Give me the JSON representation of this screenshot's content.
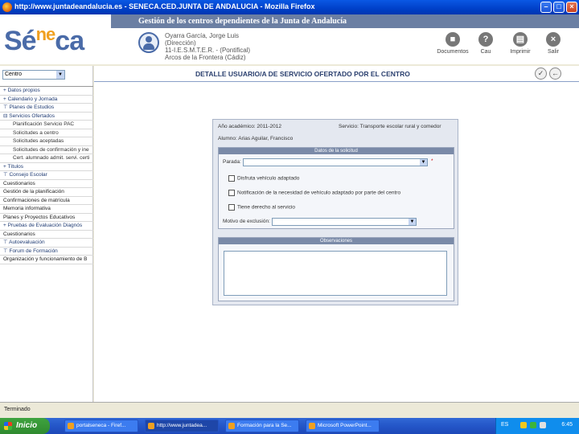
{
  "window": {
    "title": "http://www.juntadeandalucia.es - SENECA.CED.JUNTA DE ANDALUCIA - Mozilla Firefox"
  },
  "header": {
    "banner": "Gestión de los centros dependientes de la Junta de Andalucía",
    "logo_main": "Sé",
    "logo_accent": "ne",
    "logo_end": "ca",
    "user_lines": [
      "Oyarra García, Jorge Luis",
      "(Dirección)",
      "11-I.E.S.M.T.E.R. - (Pontifical)",
      "Arcos de la Frontera (Cádiz)"
    ],
    "buttons": [
      {
        "label": "Documentos",
        "icon": "documents-icon"
      },
      {
        "label": "Cau",
        "icon": "help-icon"
      },
      {
        "label": "Imprimir",
        "icon": "print-icon"
      },
      {
        "label": "Salir",
        "icon": "exit-icon"
      }
    ]
  },
  "sidebar": {
    "select_value": "Centro",
    "items": [
      {
        "label": "+ Datos propios",
        "type": "top"
      },
      {
        "label": "+ Calendario y Jornada",
        "type": "top"
      },
      {
        "label": "⊤ Planes de Estudios",
        "type": "top"
      },
      {
        "label": "⊟ Servicios Ofertados",
        "type": "top"
      },
      {
        "label": "Planificación Servicio PAC",
        "type": "sub"
      },
      {
        "label": "Solicitudes a centro",
        "type": "sub"
      },
      {
        "label": "Solicitudes aceptadas",
        "type": "sub"
      },
      {
        "label": "Solicitudes de confirmación y ine",
        "type": "sub"
      },
      {
        "label": "Cert. alumnado admit. servi. certi",
        "type": "sub"
      },
      {
        "label": "+ Títulos",
        "type": "top"
      },
      {
        "label": "⊤ Consejo Escolar",
        "type": "top"
      },
      {
        "label": "Cuestionarios",
        "type": "plain"
      },
      {
        "label": "Gestión de la planificación",
        "type": "plain"
      },
      {
        "label": "Confirmaciones de matrícula",
        "type": "plain"
      },
      {
        "label": "Memoria informativa",
        "type": "plain"
      },
      {
        "label": "Planes y Proyectos Educativos",
        "type": "plain"
      },
      {
        "label": "+ Pruebas de Evaluación Diagnós",
        "type": "top"
      },
      {
        "label": "Cuestionarios",
        "type": "plain"
      },
      {
        "label": "⊤ Autoevaluación",
        "type": "top"
      },
      {
        "label": "⊤ Forum de Formación",
        "type": "top"
      },
      {
        "label": "Organización y funcionamiento de B",
        "type": "plain"
      }
    ]
  },
  "main": {
    "title": "DETALLE USUARIO/A DE SERVICIO OFERTADO POR EL CENTRO",
    "year_label": "Año académico: 2011-2012",
    "service_label": "Servicio: Transporte escolar rural y comedor",
    "student_label": "Alumno: Arias Aguilar, Francisco",
    "request_legend": "Datos de la solicitud",
    "ruta_label": "Parada:",
    "ruta_value": "",
    "required_mark": "*",
    "check1": "Disfruta vehículo adaptado",
    "check2": "Notificación de la necesidad de vehículo adaptado por parte del centro",
    "check3": "Tiene derecho al servicio",
    "exclusion_label": "Motivo de exclusión:",
    "exclusion_value": "",
    "observ_legend": "Observaciones"
  },
  "status": {
    "text": "Terminado"
  },
  "taskbar": {
    "start": "Inicio",
    "tasks": [
      "portalseneca - Firef...",
      "http://www.juntadea...",
      "Formación para la Se...",
      "Microsoft PowerPoint..."
    ],
    "lang": "ES",
    "clock": "6:45"
  }
}
